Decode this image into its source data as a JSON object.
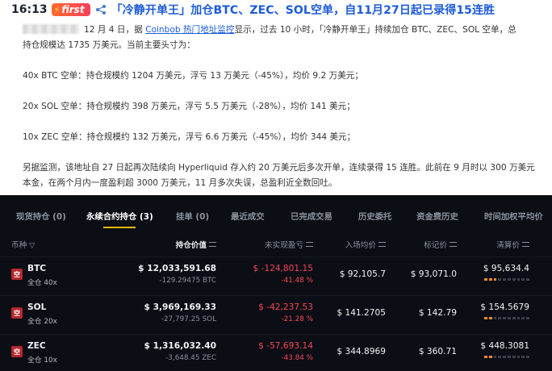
{
  "article": {
    "time": "16:13",
    "badge": "first",
    "headline": "「冷静开单王」加仓BTC、ZEC、SOL空单，自11月27日起已录得15连胜",
    "line1_date": "12 月 4 日，据 ",
    "line1_link": "Coinbob 热门地址监控",
    "line1_rest": "显示，过去 10 小时，「冷静开单王」持续加仓 BTC、ZEC、SOL 空单，总",
    "line2": "持仓规模达 1735 万美元。当前主要头寸为：",
    "pos_btc": "40x BTC 空单：持仓规模约 1204 万美元，浮亏 13 万美元（-45%），均价 9.2 万美元；",
    "pos_sol": "20x SOL 空单：持仓规模约 398 万美元，浮亏 5.5 万美元（-28%），均价 141 美元；",
    "pos_zec": "10x ZEC 空单：持仓规模约 132 万美元，浮亏 6.6 万美元（-45%），均价 344 美元；",
    "extra1": "另据监测，该地址自 27 日起再次陆续向 Hyperliquid 存入约 20 万美元后多次开单，连续录得 15 连胜。此前在 9 月时以 300 万美元",
    "extra2": "本金，在两个月内一度盈利超 3000 万美元，11 月多次失误，总盈利近全数回吐。"
  },
  "tabs": [
    {
      "label": "现货持仓 (0)"
    },
    {
      "label": "永续合约持仓 (3)"
    },
    {
      "label": "挂单 (0)"
    },
    {
      "label": "最近成交"
    },
    {
      "label": "已完成交易"
    },
    {
      "label": "历史委托"
    },
    {
      "label": "资金费历史"
    },
    {
      "label": "时间加权平均价"
    }
  ],
  "columns": {
    "coin": "币种",
    "value": "持仓价值",
    "pnl": "未实现盈亏",
    "entry": "入场均价",
    "mark": "标记价",
    "liq": "清算价"
  },
  "positions": [
    {
      "icon": "空",
      "symbol": "BTC",
      "leverage": "全仓 40x",
      "value": "$ 12,033,591.68",
      "qty": "-129.29475 BTC",
      "pnl": "$ -124,801.15",
      "pnl_pct": "-41.48 %",
      "entry": "$ 92,105.7",
      "mark": "$ 93,071.0",
      "liq": "$ 95,634.4",
      "risk_bars": 3
    },
    {
      "icon": "空",
      "symbol": "SOL",
      "leverage": "全仓 20x",
      "value": "$ 3,969,169.33",
      "qty": "-27,797.25 SOL",
      "pnl": "$ -42,237.53",
      "pnl_pct": "-21.28 %",
      "entry": "$ 141.2705",
      "mark": "$ 142.79",
      "liq": "$ 154.5679",
      "risk_bars": 2
    },
    {
      "icon": "空",
      "symbol": "ZEC",
      "leverage": "全仓 10x",
      "value": "$ 1,316,032.40",
      "qty": "-3,648.45 ZEC",
      "pnl": "$ -57,693.14",
      "pnl_pct": "-43.84 %",
      "entry": "$ 344.8969",
      "mark": "$ 360.71",
      "liq": "$ 448.3081",
      "risk_bars": 2
    }
  ],
  "colors": {
    "accent": "#f0b90b",
    "negative": "#f6465d",
    "link": "#1d5bd8",
    "panel_bg": "#0b0e14"
  }
}
